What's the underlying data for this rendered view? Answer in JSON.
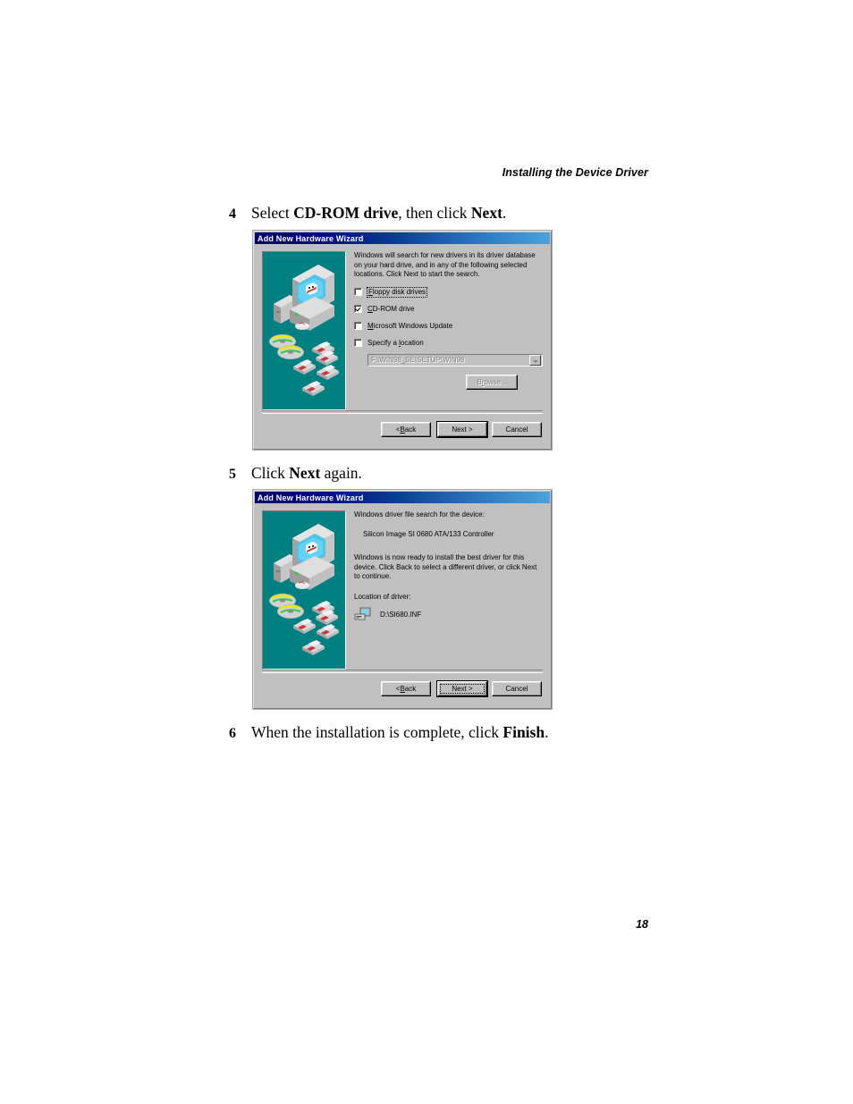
{
  "page": {
    "running_head": "Installing the Device Driver",
    "page_number": "18"
  },
  "steps": [
    {
      "number": "4",
      "text_before": "Select ",
      "bold1": "CD-ROM drive",
      "text_middle": ", then click ",
      "bold2": "Next",
      "text_after": "."
    },
    {
      "number": "5",
      "text_before": "Click ",
      "bold1": "Next",
      "text_middle": " again.",
      "bold2": "",
      "text_after": ""
    },
    {
      "number": "6",
      "text_before": "When the installation is complete, click ",
      "bold1": "Finish",
      "text_middle": ".",
      "bold2": "",
      "text_after": ""
    }
  ],
  "dialog1": {
    "title": "Add New Hardware Wizard",
    "body_text": "Windows will search for new drivers in its driver database on your hard drive, and in any of the following selected locations. Click Next to start the search.",
    "checkboxes": [
      {
        "label_underline": "F",
        "label_rest": "loppy disk drives",
        "checked": false,
        "focused": true
      },
      {
        "label_underline": "C",
        "label_rest": "D-ROM drive",
        "checked": true,
        "focused": false
      },
      {
        "label_underline": "M",
        "label_rest": "icrosoft Windows Update",
        "checked": false,
        "focused": false
      },
      {
        "label_underline": "l",
        "label_rest": "ocation",
        "label_prefix": "Specify a ",
        "checked": false,
        "focused": false
      }
    ],
    "location_value": "F:\\WIN98_SE\\SETUP\\WIN98",
    "browse_label_underline": "r",
    "browse_label_before": "B",
    "browse_label_after": "owse...",
    "buttons": {
      "back_before": "< ",
      "back_underline": "B",
      "back_after": "ack",
      "next": "Next >",
      "cancel": "Cancel"
    }
  },
  "dialog2": {
    "title": "Add New Hardware Wizard",
    "line1": "Windows driver file search for the device:",
    "device_name": "Silicon Image SI 0680 ATA/133 Controller",
    "line2": "Windows is now ready to install the best driver for this device. Click Back to select a different driver, or click Next to continue.",
    "location_label": "Location of driver:",
    "driver_path": "D:\\SI680.INF",
    "buttons": {
      "back_before": "< ",
      "back_underline": "B",
      "back_after": "ack",
      "next": "Next >",
      "cancel": "Cancel"
    }
  },
  "colors": {
    "titlebar_dark": "#000083",
    "titlebar_light": "#4aa3dc",
    "dialog_face": "#c0c0c0",
    "illustration_bg": "#008080"
  }
}
